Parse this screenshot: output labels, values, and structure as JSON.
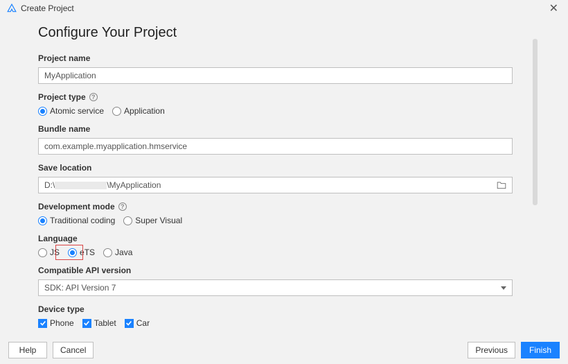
{
  "window": {
    "title": "Create Project"
  },
  "page": {
    "title": "Configure Your Project"
  },
  "fields": {
    "project_name": {
      "label": "Project name",
      "value": "MyApplication"
    },
    "project_type": {
      "label": "Project type",
      "options": [
        {
          "label": "Atomic service",
          "selected": true
        },
        {
          "label": "Application",
          "selected": false
        }
      ]
    },
    "bundle_name": {
      "label": "Bundle name",
      "value": "com.example.myapplication.hmservice"
    },
    "save_location": {
      "label": "Save location",
      "prefix": "D:\\",
      "suffix": "\\MyApplication"
    },
    "development_mode": {
      "label": "Development mode",
      "options": [
        {
          "label": "Traditional coding",
          "selected": true
        },
        {
          "label": "Super Visual",
          "selected": false
        }
      ]
    },
    "language": {
      "label": "Language",
      "options": [
        {
          "label": "JS",
          "selected": false
        },
        {
          "label": "eTS",
          "selected": true
        },
        {
          "label": "Java",
          "selected": false
        }
      ]
    },
    "compatible_api": {
      "label": "Compatible API version",
      "value": "SDK: API Version 7"
    },
    "device_type": {
      "label": "Device type",
      "options": [
        {
          "label": "Phone",
          "checked": true
        },
        {
          "label": "Tablet",
          "checked": true
        },
        {
          "label": "Car",
          "checked": true
        }
      ]
    }
  },
  "footer": {
    "help": "Help",
    "cancel": "Cancel",
    "previous": "Previous",
    "finish": "Finish"
  }
}
